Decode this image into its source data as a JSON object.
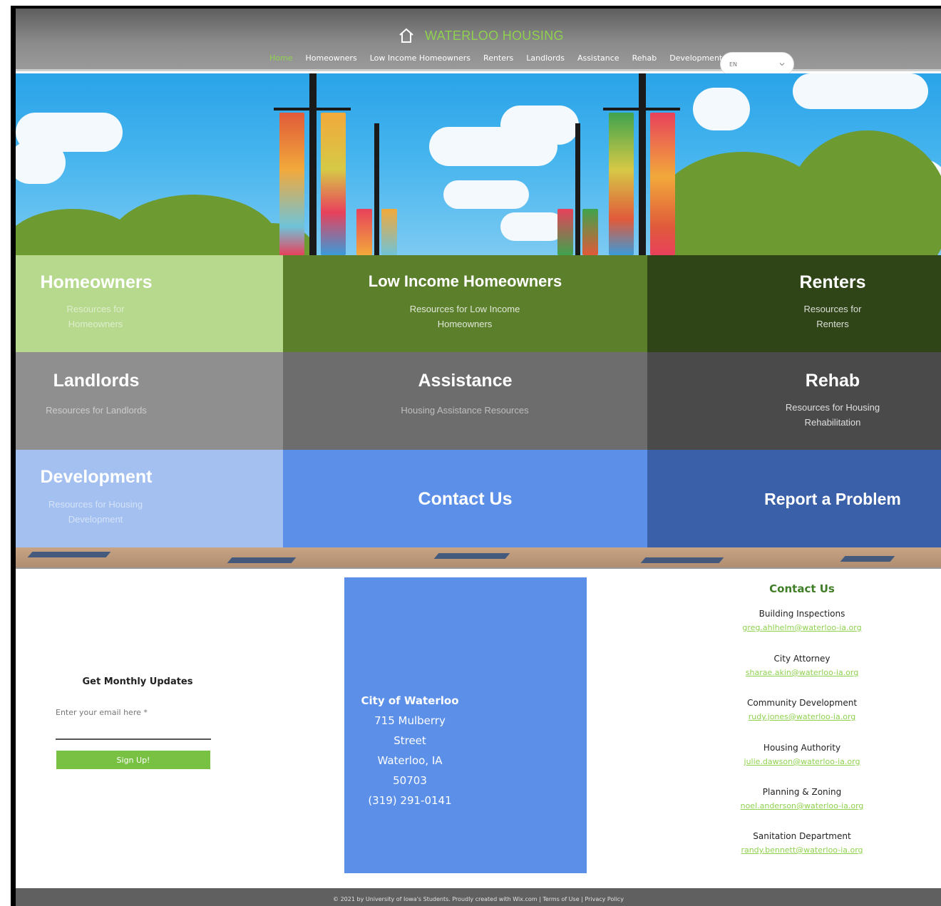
{
  "header": {
    "brand": "WATERLOO HOUSING",
    "nav": [
      "Home",
      "Homeowners",
      "Low Income Homeowners",
      "Renters",
      "Landlords",
      "Assistance",
      "Rehab",
      "Development"
    ],
    "active_nav": "Home",
    "language": "EN"
  },
  "tiles": [
    {
      "title": "Homeowners",
      "subtitle": "Resources for Homeowners",
      "color": "#b7d98e"
    },
    {
      "title": "Low Income Homeowners",
      "subtitle": "Resources for Low Income Homeowners",
      "color": "#5b7f2b"
    },
    {
      "title": "Renters",
      "subtitle": "Resources for Renters",
      "color": "#2f4417"
    },
    {
      "title": "Landlords",
      "subtitle": "Resources for Landlords",
      "color": "#8f8f8f"
    },
    {
      "title": "Assistance",
      "subtitle": "Housing Assistance Resources",
      "color": "#6d6d6d"
    },
    {
      "title": "Rehab",
      "subtitle": "Resources for Housing Rehabilitation",
      "color": "#4a4a4a"
    },
    {
      "title": "Development",
      "subtitle": "Resources for Housing Development",
      "color": "#a3c0f0"
    },
    {
      "title": "Contact Us",
      "subtitle": "",
      "color": "#5b8fe8"
    },
    {
      "title": "Report a Problem",
      "subtitle": "",
      "color": "#3960a8"
    }
  ],
  "signup": {
    "title": "Get Monthly Updates",
    "placeholder": "Enter your email here *",
    "button": "Sign Up!"
  },
  "address": {
    "title": "City of Waterloo",
    "street": "715 Mulberry Street",
    "city": "Waterloo, IA 50703",
    "phone": "(319) 291-0141"
  },
  "contacts": {
    "title": "Contact Us",
    "items": [
      {
        "name": "Building Inspections",
        "email": "greg.ahlhelm@waterloo-ia.org"
      },
      {
        "name": "City Attorney",
        "email": "sharae.akin@waterloo-ia.org"
      },
      {
        "name": "Community Development",
        "email": "rudy.jones@waterloo-ia.org"
      },
      {
        "name": "Housing Authority",
        "email": "julie.dawson@waterloo-ia.org"
      },
      {
        "name": "Planning & Zoning",
        "email": "noel.anderson@waterloo-ia.org"
      },
      {
        "name": "Sanitation Department",
        "email": "randy.bennett@waterloo-ia.org"
      }
    ]
  },
  "footer": {
    "text": "© 2021 by University of Iowa's Students. Proudly created with Wix.com | Terms of Use | Privacy Policy"
  }
}
